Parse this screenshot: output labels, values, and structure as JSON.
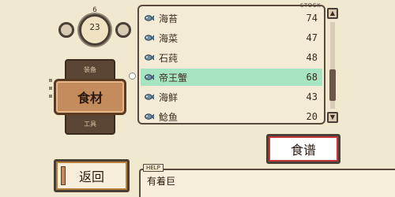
{
  "date": {
    "month": "6",
    "day": "23"
  },
  "category": {
    "previous": "装备",
    "current": "食材",
    "next": "工具"
  },
  "list": {
    "stock_header": "STOCK",
    "items": [
      {
        "name": "海苔",
        "qty": "74",
        "icon": "fish-icon"
      },
      {
        "name": "海菜",
        "qty": "47",
        "icon": "fish-icon"
      },
      {
        "name": "石莼",
        "qty": "48",
        "icon": "fish-icon"
      },
      {
        "name": "帝王蟹",
        "qty": "68",
        "icon": "fish-icon"
      },
      {
        "name": "海鲜",
        "qty": "43",
        "icon": "fish-icon"
      },
      {
        "name": "鲶鱼",
        "qty": "20",
        "icon": "fish-icon"
      }
    ],
    "selected_index": 3
  },
  "buttons": {
    "recipe": "食谱",
    "back": "返回"
  },
  "help": {
    "tag": "HELP",
    "text": "有着巨"
  },
  "colors": {
    "selected_row": "#a7e4c2",
    "recipe_accent": "#c1373a",
    "category_wood": "#c48b5c"
  }
}
